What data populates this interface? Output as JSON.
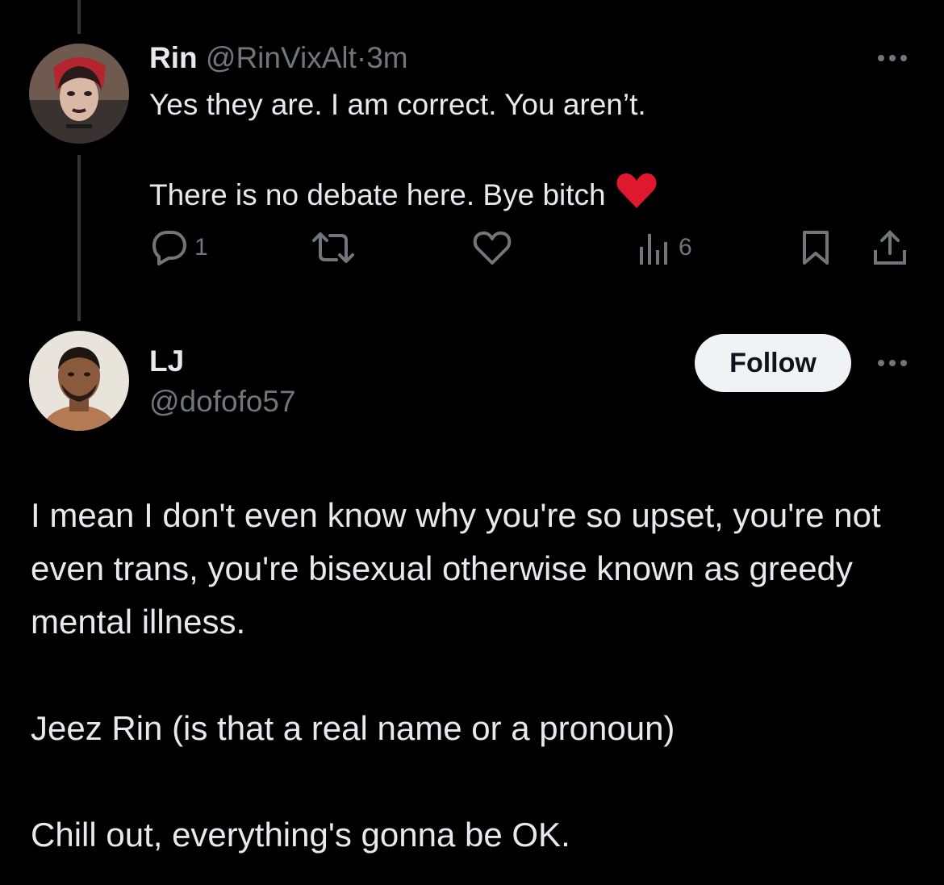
{
  "reply": {
    "name": "Rin",
    "handle": "@RinVixAlt",
    "separator": "·",
    "time": "3m",
    "lines": [
      "Yes they are. I am correct. You aren’t.",
      "There is no debate here. Bye bitch"
    ],
    "heart_emoji": "heart-emoji",
    "actions": {
      "replies": "1",
      "reposts": "",
      "likes": "",
      "views": "6"
    },
    "icons": [
      "reply-icon",
      "repost-icon",
      "like-icon",
      "views-icon",
      "bookmark-icon",
      "share-icon",
      "more-icon"
    ]
  },
  "post": {
    "name": "LJ",
    "handle": "@dofofo57",
    "follow_label": "Follow",
    "paragraphs": [
      "I mean I don't even know why you're so upset, you're not even trans, you're bisexual otherwise known as greedy mental illness.",
      "Jeez Rin (is that a real name or a pronoun)",
      "Chill out, everything's gonna be OK."
    ]
  },
  "colors": {
    "background": "#000000",
    "text_primary": "#e7e9ea",
    "text_secondary": "#71767b",
    "thread_line": "#333639",
    "follow_bg": "#eff3f4",
    "heart": "#e0182d"
  }
}
